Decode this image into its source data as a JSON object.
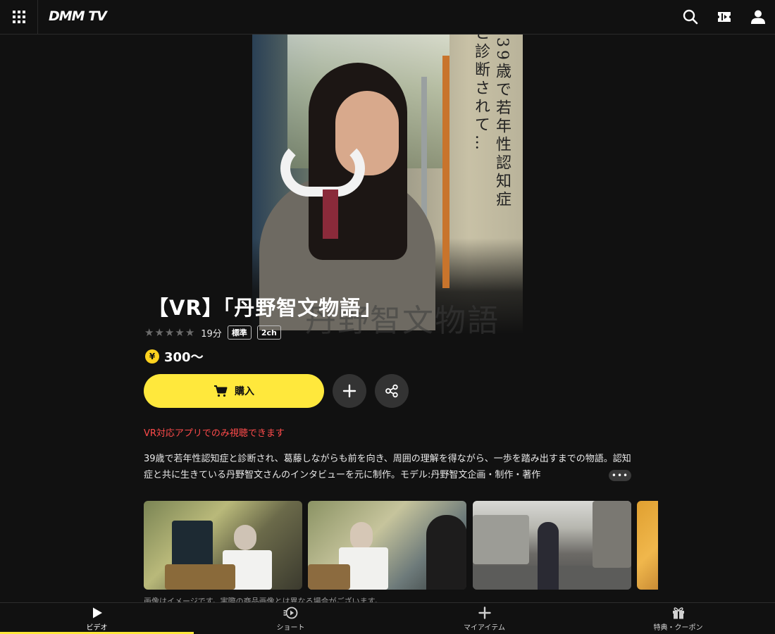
{
  "header": {
    "logo": "DMM TV",
    "icons": [
      "apps-grid-icon",
      "search-icon",
      "ticket-icon",
      "user-icon"
    ]
  },
  "hero": {
    "vertical_text_1": "39歳で若年性認知症",
    "vertical_text_2": "と診断されて…",
    "background_title": "丹野智文物語"
  },
  "content": {
    "title": "【VR】「丹野智文物語」",
    "rating_stars": 0,
    "duration": "19分",
    "tags": [
      "標準",
      "2ch"
    ],
    "price_symbol": "¥",
    "price": "300〜",
    "buy_label": "購入",
    "vr_note": "VR対応アプリでのみ視聴できます",
    "description": "39歳で若年性認知症と診断され、葛藤しながらも前を向き、周囲の理解を得ながら、一歩を踏み出すまでの物語。認知症と共に生きている丹野智文さんのインタビューを元に制作。モデル:丹野智文企画・制作・著作",
    "more_label": "•••",
    "caption": "画像はイメージです。実際の商品画像とは異なる場合がございます。"
  },
  "bottom_nav": [
    {
      "label": "ビデオ",
      "icon": "play-icon",
      "active": true
    },
    {
      "label": "ショート",
      "icon": "short-play-icon",
      "active": false
    },
    {
      "label": "マイアイテム",
      "icon": "plus-icon",
      "active": false
    },
    {
      "label": "特典・クーポン",
      "icon": "gift-icon",
      "active": false
    }
  ],
  "colors": {
    "background": "#111111",
    "accent_yellow": "#ffe83c",
    "note_red": "#ff4b4b"
  }
}
